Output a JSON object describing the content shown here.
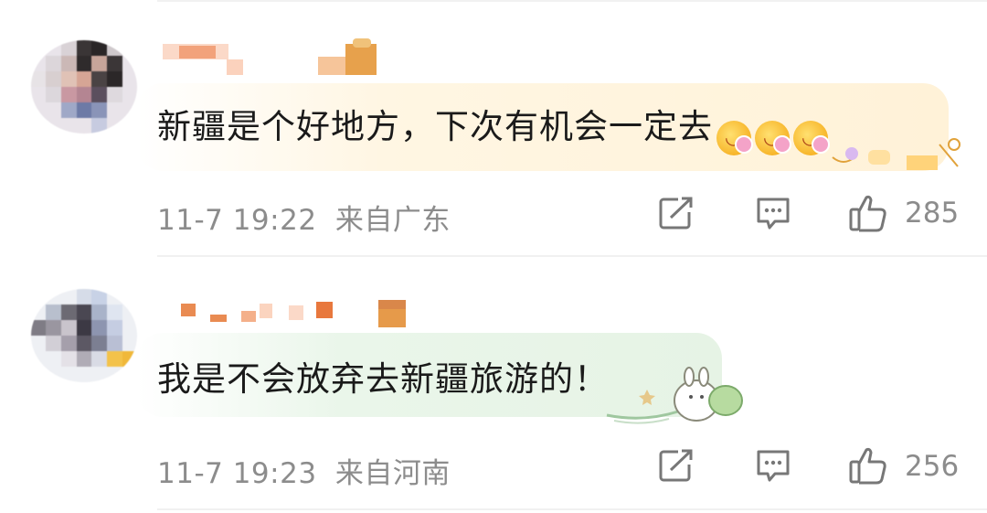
{
  "comments": [
    {
      "content": "新疆是个好地方，下次有机会一定去",
      "emoji_icons": [
        "flower-smile-emoji-icon",
        "flower-smile-emoji-icon",
        "flower-smile-emoji-icon"
      ],
      "time": "11-7 19:22",
      "location": "来自广东",
      "likes": "285"
    },
    {
      "content": "我是不会放弃去新疆旅游的！",
      "time": "11-7 19:23",
      "location": "来自河南",
      "likes": "256"
    }
  ],
  "icons": {
    "share": "share-icon",
    "reply": "comment-icon",
    "like": "thumbs-up-icon"
  },
  "colors": {
    "bubble_orange": "#fff2d8",
    "bubble_green": "#e6f3e5",
    "meta_text": "#8c8c8c",
    "divider": "#f1f1f1"
  }
}
